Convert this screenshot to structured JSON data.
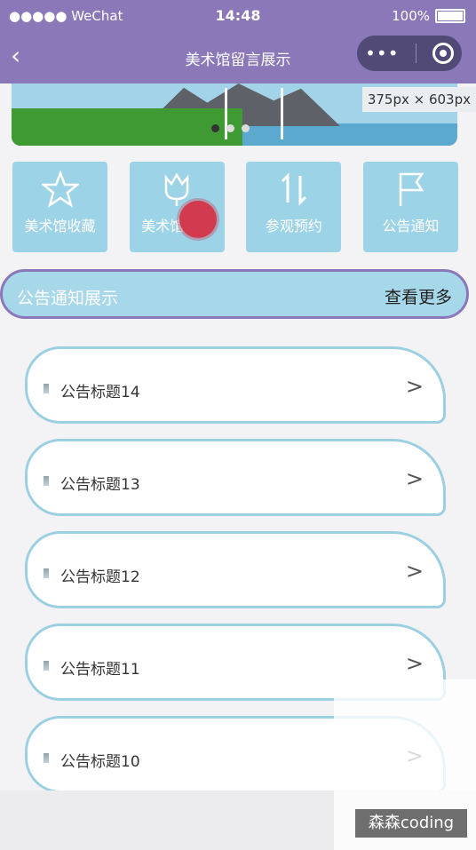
{
  "status": {
    "carrier": "●●●●● WeChat",
    "time": "14:48",
    "battery": "100%"
  },
  "nav": {
    "back": "‹",
    "title": "美术馆留言展示",
    "capsule_dots": "•••"
  },
  "banner": {
    "size_tag": "375px × 603px"
  },
  "menu": [
    {
      "icon": "star-icon",
      "label": "美术馆收藏"
    },
    {
      "icon": "tulip-icon",
      "label": "美术馆留言"
    },
    {
      "icon": "sort-arrows-icon",
      "label": "参观预约"
    },
    {
      "icon": "flag-icon",
      "label": "公告通知"
    }
  ],
  "section": {
    "title": "公告通知展示",
    "more": "查看更多"
  },
  "notices": [
    {
      "title": "公告标题14",
      "chevron": ">"
    },
    {
      "title": "公告标题13",
      "chevron": ">"
    },
    {
      "title": "公告标题12",
      "chevron": ">"
    },
    {
      "title": "公告标题11",
      "chevron": ">"
    },
    {
      "title": "公告标题10",
      "chevron": ">"
    }
  ],
  "watermark": "森森coding",
  "colors": {
    "primary": "#8a78b8",
    "accent": "#9dd3e6",
    "capsule": "#514a77"
  }
}
